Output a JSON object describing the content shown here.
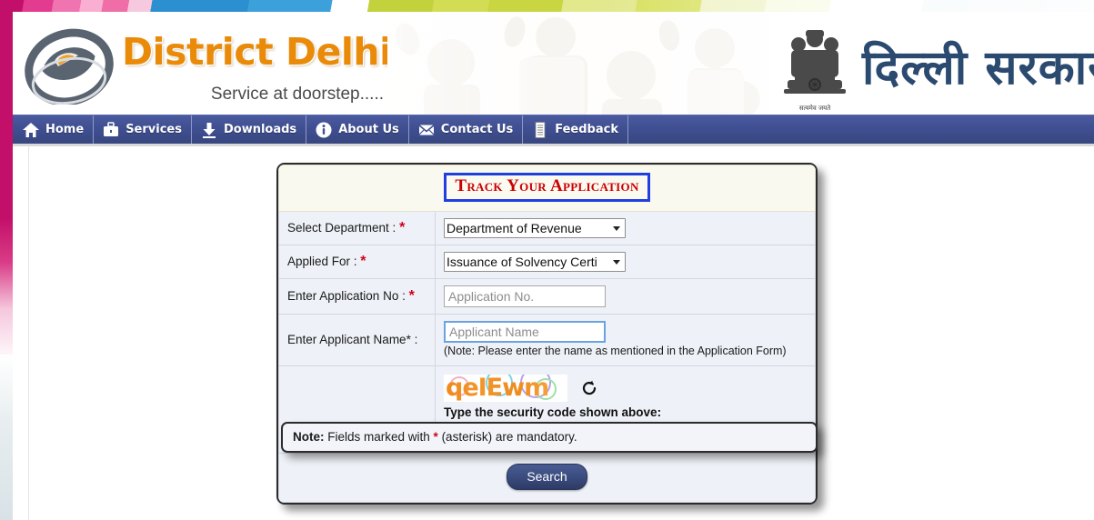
{
  "site": {
    "logo_title": "District Delhi",
    "logo_tagline": "Service at doorstep.....",
    "emblem_caption": "सत्यमेव जयते",
    "govt_name_hindi": "दिल्ली सरकार"
  },
  "nav": {
    "items": [
      {
        "label": "Home",
        "icon": "home-icon"
      },
      {
        "label": "Services",
        "icon": "briefcase-icon"
      },
      {
        "label": "Downloads",
        "icon": "download-icon"
      },
      {
        "label": "About Us",
        "icon": "info-icon"
      },
      {
        "label": "Contact Us",
        "icon": "envelope-icon"
      },
      {
        "label": "Feedback",
        "icon": "document-icon"
      }
    ]
  },
  "form": {
    "title": "Track Your Application",
    "fields": {
      "department": {
        "label": "Select Department : ",
        "required_mark": "*",
        "value": "Department of Revenue"
      },
      "applied_for": {
        "label": "Applied For : ",
        "required_mark": "*",
        "value": "Issuance of Solvency Certi"
      },
      "application_no": {
        "label": "Enter Application No : ",
        "required_mark": "*",
        "placeholder": "Application No."
      },
      "applicant_name": {
        "label": "Enter Applicant Name* : ",
        "placeholder": "Applicant Name",
        "hint": "(Note: Please enter the name as mentioned in the Application Form)"
      },
      "captcha": {
        "code_text": "qeIEwm",
        "refresh_icon": "refresh-icon",
        "prompt": "Type the security code shown above:",
        "input_value": ""
      }
    },
    "search_button": "Search"
  },
  "footer_note": {
    "prefix": "Note:",
    "text_before_star": " Fields marked with ",
    "star": "*",
    "text_after_star": " (asterisk) are mandatory."
  },
  "colors": {
    "accent_orange": "#e98a08",
    "nav_blue": "#3f4f92",
    "title_red": "#cc0000",
    "title_border_blue": "#1f3fe0",
    "required_red": "#d0021b",
    "ribbon_magenta": "#c2106a"
  }
}
